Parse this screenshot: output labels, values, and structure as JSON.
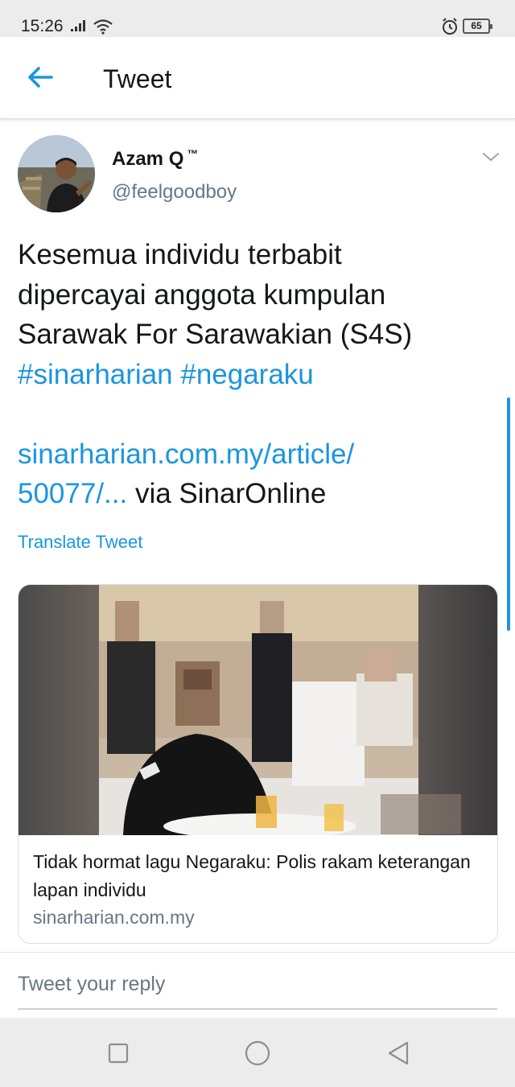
{
  "status_bar": {
    "time": "15:26",
    "battery": "65"
  },
  "header": {
    "title": "Tweet"
  },
  "tweet": {
    "display_name": "Azam Q",
    "name_badge": "™",
    "handle": "@feelgoodboy",
    "text_line1": "Kesemua individu terbabit",
    "text_line2": "dipercayai anggota kumpulan",
    "text_line3": "Sarawak For Sarawakian (S4S)",
    "hashtag1": "#sinarharian",
    "hashtag2": "#negaraku",
    "link_part1": "sinarharian.com.my/article/",
    "link_part2": "50077/...",
    "via_text": " via SinarOnline",
    "translate_label": "Translate Tweet"
  },
  "card": {
    "title": "Tidak hormat lagu Negaraku: Polis rakam keterangan lapan individu",
    "domain": "sinarharian.com.my"
  },
  "reply": {
    "placeholder": "Tweet your reply"
  },
  "colors": {
    "accent": "#1b95e0",
    "secondary_text": "#657786",
    "primary_text": "#14171a"
  }
}
